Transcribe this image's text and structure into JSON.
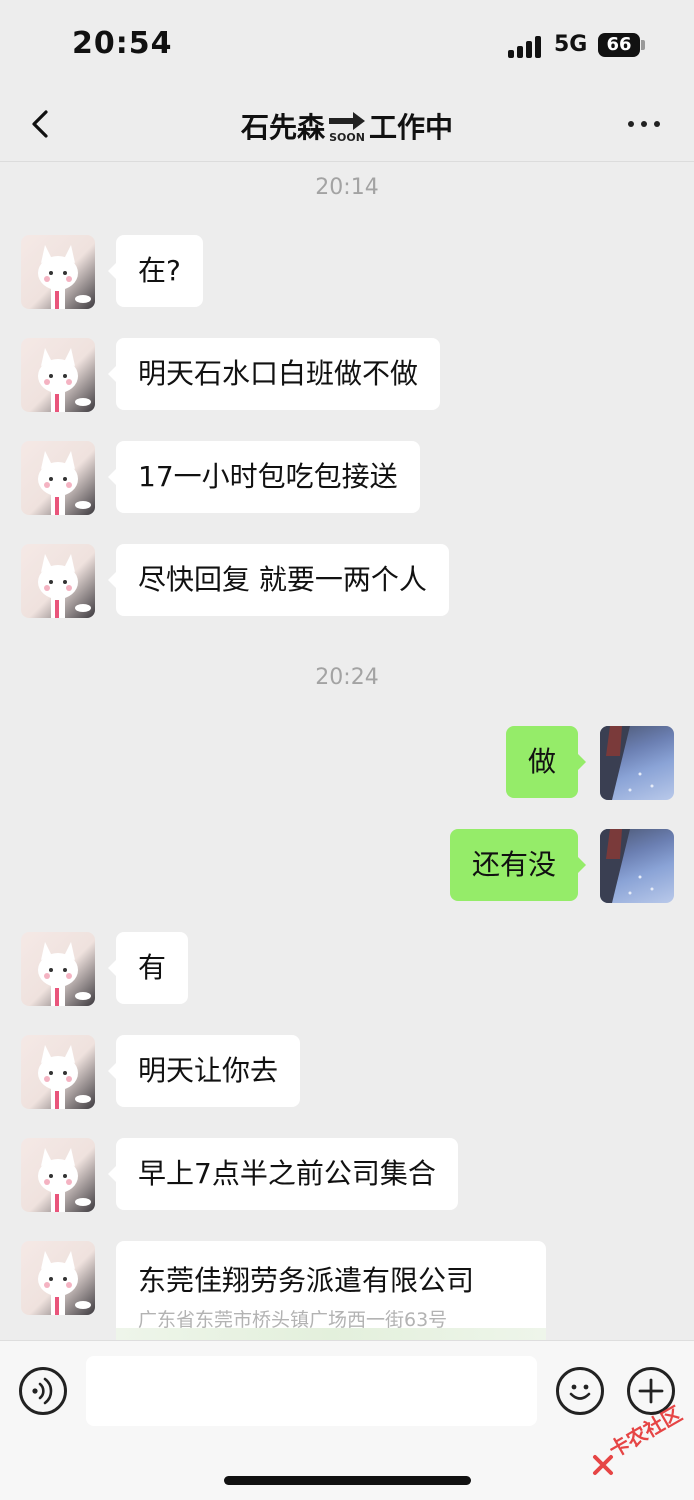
{
  "status_bar": {
    "time": "20:54",
    "network": "5G",
    "battery": "66"
  },
  "header": {
    "title_prefix": "石先森",
    "title_sticker": "SOON",
    "title_suffix": "工作中",
    "back_icon": "chevron-left-icon",
    "more_icon": "more-horizontal-icon"
  },
  "messages": [
    {
      "type": "time",
      "text": "20:14"
    },
    {
      "type": "incoming",
      "text": "在?"
    },
    {
      "type": "incoming",
      "text": "明天石水口白班做不做"
    },
    {
      "type": "incoming",
      "text": "17一小时包吃包接送"
    },
    {
      "type": "incoming",
      "text": "尽快回复 就要一两个人"
    },
    {
      "type": "time",
      "text": "20:24"
    },
    {
      "type": "outgoing",
      "text": "做"
    },
    {
      "type": "outgoing",
      "text": "还有没"
    },
    {
      "type": "incoming",
      "text": "有"
    },
    {
      "type": "incoming",
      "text": "明天让你去"
    },
    {
      "type": "incoming",
      "text": "早上7点半之前公司集合"
    },
    {
      "type": "location",
      "name": "东莞佳翔劳务派遣有限公司",
      "address": "广东省东莞市桥头镇广场西一街63号"
    }
  ],
  "input_bar": {
    "voice_icon": "voice-icon",
    "emoji_icon": "emoji-icon",
    "plus_icon": "plus-icon",
    "value": ""
  },
  "watermark": {
    "text": "卡农社区"
  },
  "colors": {
    "background": "#ededed",
    "incoming_bubble": "#ffffff",
    "outgoing_bubble": "#95ec69",
    "timestamp": "#a3a3a3"
  }
}
